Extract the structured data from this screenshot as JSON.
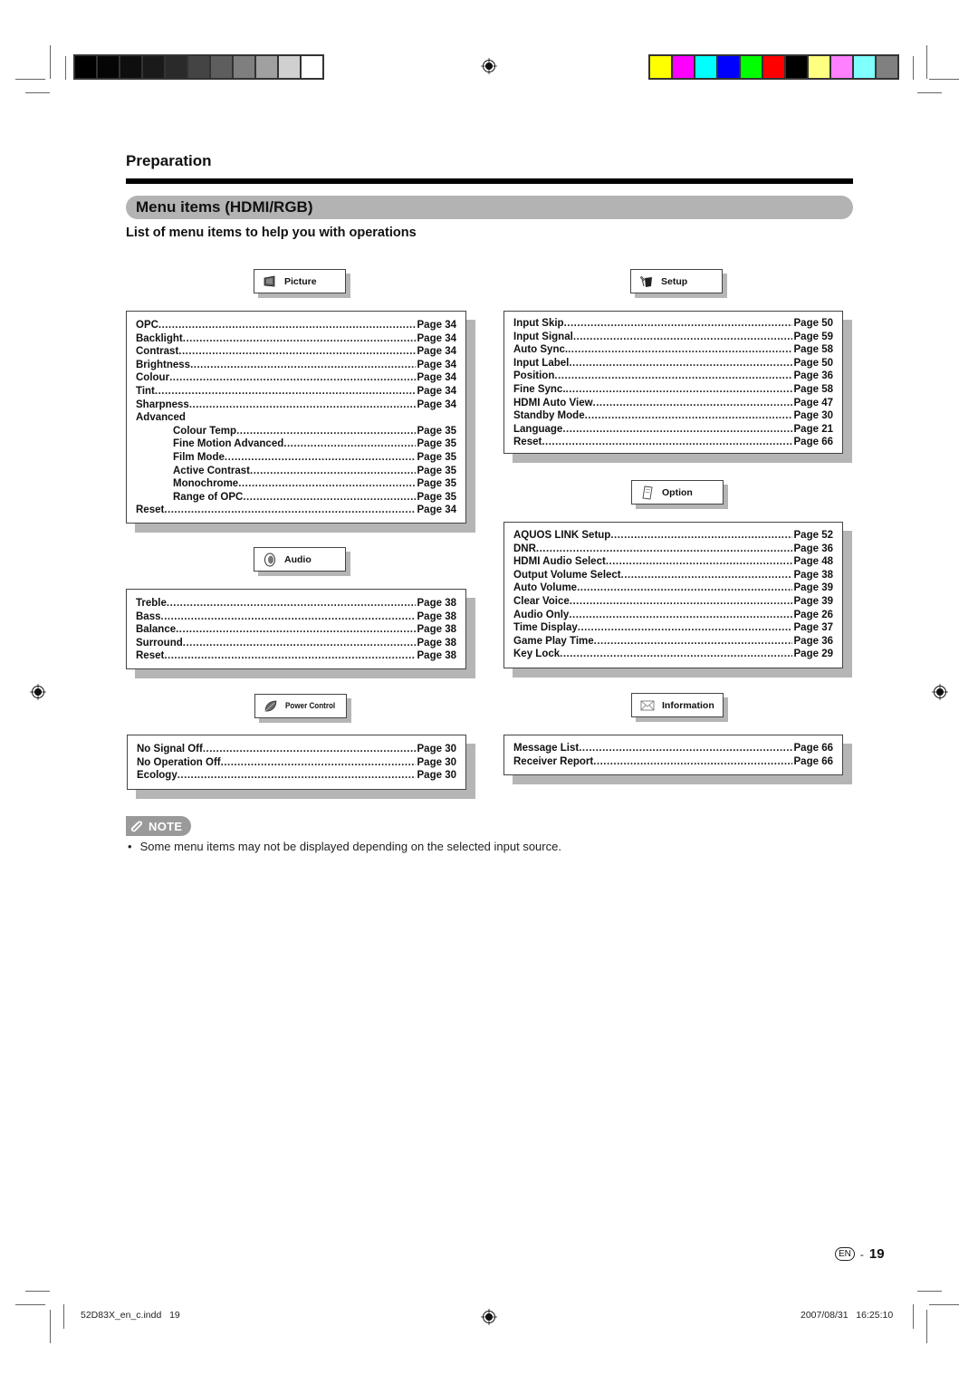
{
  "print_marks": {
    "gray_bars": [
      "#000000",
      "#050505",
      "#0e0e0e",
      "#1a1a1a",
      "#2a2a2a",
      "#444444",
      "#5e5e5e",
      "#7f7f7f",
      "#a0a0a0",
      "#d0d0d0",
      "#ffffff"
    ],
    "color_bars": [
      "#ffff00",
      "#ff00ff",
      "#00ffff",
      "#0000ff",
      "#00ff00",
      "#ff0000",
      "#000000",
      "#ffff80",
      "#ff80ff",
      "#80ffff",
      "#808080"
    ]
  },
  "header": {
    "section": "Preparation",
    "title": "Menu items (HDMI/RGB)",
    "subtitle": "List of menu items to help you with operations"
  },
  "menus": {
    "picture": {
      "label": "Picture",
      "icon": "picture-icon",
      "items": [
        {
          "name": "OPC",
          "page": "Page 34",
          "indent": false
        },
        {
          "name": "Backlight",
          "page": "Page 34",
          "indent": false
        },
        {
          "name": "Contrast",
          "page": "Page 34",
          "indent": false
        },
        {
          "name": "Brightness",
          "page": "Page 34",
          "indent": false
        },
        {
          "name": "Colour",
          "page": "Page 34",
          "indent": false
        },
        {
          "name": "Tint",
          "page": "Page 34",
          "indent": false
        },
        {
          "name": "Sharpness",
          "page": "Page 34",
          "indent": false
        },
        {
          "name": "Advanced",
          "page": "",
          "indent": false
        },
        {
          "name": "Colour Temp",
          "page": "Page 35",
          "indent": true
        },
        {
          "name": "Fine Motion Advanced",
          "page": "Page 35",
          "indent": true
        },
        {
          "name": "Film Mode",
          "page": "Page 35",
          "indent": true
        },
        {
          "name": "Active Contrast",
          "page": "Page 35",
          "indent": true
        },
        {
          "name": "Monochrome",
          "page": "Page 35",
          "indent": true
        },
        {
          "name": "Range of OPC",
          "page": "Page 35",
          "indent": true
        },
        {
          "name": "Reset",
          "page": "Page 34",
          "indent": false
        }
      ]
    },
    "audio": {
      "label": "Audio",
      "icon": "speaker-icon",
      "items": [
        {
          "name": "Treble",
          "page": "Page 38"
        },
        {
          "name": "Bass",
          "page": "Page 38"
        },
        {
          "name": "Balance",
          "page": "Page 38"
        },
        {
          "name": "Surround",
          "page": "Page 38"
        },
        {
          "name": "Reset",
          "page": "Page 38"
        }
      ]
    },
    "power_control": {
      "label": "Power Control",
      "icon": "leaf-icon",
      "items": [
        {
          "name": "No Signal Off",
          "page": "Page 30"
        },
        {
          "name": "No Operation Off",
          "page": "Page 30"
        },
        {
          "name": "Ecology",
          "page": "Page 30"
        }
      ]
    },
    "setup": {
      "label": "Setup",
      "icon": "wrench-icon",
      "items": [
        {
          "name": "Input Skip",
          "page": "Page 50"
        },
        {
          "name": "Input Signal",
          "page": "Page 59"
        },
        {
          "name": "Auto Sync.",
          "page": "Page 58"
        },
        {
          "name": "Input Label",
          "page": "Page 50"
        },
        {
          "name": "Position",
          "page": "Page 36"
        },
        {
          "name": "Fine Sync.",
          "page": "Page 58"
        },
        {
          "name": "HDMI Auto View",
          "page": "Page 47"
        },
        {
          "name": "Standby Mode",
          "page": "Page 30"
        },
        {
          "name": "Language",
          "page": "Page 21"
        },
        {
          "name": "Reset",
          "page": "Page 66"
        }
      ]
    },
    "option": {
      "label": "Option",
      "icon": "option-icon",
      "items": [
        {
          "name": "AQUOS LINK Setup",
          "page": "Page 52"
        },
        {
          "name": "DNR",
          "page": "Page 36"
        },
        {
          "name": "HDMI Audio Select",
          "page": "Page 48"
        },
        {
          "name": "Output Volume Select",
          "page": "Page 38"
        },
        {
          "name": "Auto Volume",
          "page": "Page 39"
        },
        {
          "name": "Clear Voice",
          "page": "Page 39"
        },
        {
          "name": "Audio Only",
          "page": "Page 26"
        },
        {
          "name": "Time Display",
          "page": "Page 37"
        },
        {
          "name": "Game Play Time",
          "page": "Page 36"
        },
        {
          "name": "Key Lock",
          "page": "Page 29"
        }
      ]
    },
    "information": {
      "label": "Information",
      "icon": "envelope-icon",
      "items": [
        {
          "name": "Message List",
          "page": "Page 66"
        },
        {
          "name": "Receiver Report",
          "page": "Page 66"
        }
      ]
    }
  },
  "note": {
    "badge": "NOTE",
    "bullet": "•",
    "text": "Some menu items may not be displayed depending on the selected input source."
  },
  "page_number": {
    "lang": "EN",
    "separator": "-",
    "number": "19"
  },
  "footer": {
    "file": "52D83X_en_c.indd   19",
    "timestamp": "2007/08/31   16:25:10"
  }
}
